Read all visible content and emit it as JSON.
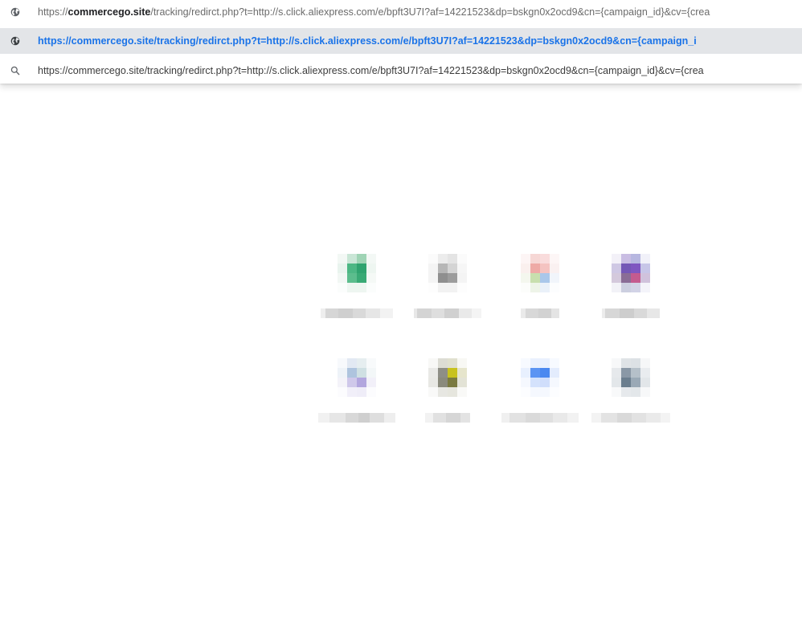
{
  "omnibox_suggestions": [
    {
      "icon": "globe-icon",
      "url_prefix": "https://",
      "url_domain": "commercego.site",
      "url_rest": "/tracking/redirct.php?t=http://s.click.aliexpress.com/e/bpft3U7I?af=14221523&dp=bskgn0x2ocd9&cn={campaign_id}&cv={crea"
    },
    {
      "icon": "globe-icon",
      "url": "https://commercego.site/tracking/redirct.php?t=http://s.click.aliexpress.com/e/bpft3U7I?af=14221523&dp=bskgn0x2ocd9&cn={campaign_i",
      "selected": true
    },
    {
      "icon": "search-icon",
      "url": "https://commercego.site/tracking/redirct.php?t=http://s.click.aliexpress.com/e/bpft3U7I?af=14221523&dp=bskgn0x2ocd9&cn={campaign_id}&cv={crea"
    }
  ],
  "colors": {
    "selected_row_bg": "#e3e5e8",
    "selected_text": "#1a73e8"
  },
  "shortcuts": [
    {
      "icon": "blurred-favicon-green",
      "colors": [
        "#f3f8f5",
        "#c9e6d6",
        "#9fd4b5",
        "#f3f8f5",
        "#e9f4ee",
        "#4cb784",
        "#2fa36f",
        "#eef6f1",
        "#f2f7f4",
        "#5cbd8d",
        "#39aa75",
        "#f5f9f6",
        "#fbfdfc",
        "#eef6f1",
        "#eef6f1",
        "#fbfdfc"
      ]
    },
    {
      "icon": "blurred-favicon-gray",
      "colors": [
        "#fbfbfb",
        "#ececec",
        "#e4e4e4",
        "#fbfbfb",
        "#f4f4f4",
        "#b6b6b6",
        "#d4d4d4",
        "#f6f6f6",
        "#f4f4f4",
        "#8f8f8f",
        "#9c9c9c",
        "#f4f4f4",
        "#fdfdfd",
        "#f2f2f2",
        "#f2f2f2",
        "#fdfdfd"
      ]
    },
    {
      "icon": "blurred-favicon-multicolor",
      "colors": [
        "#fdf5f5",
        "#f6d7d5",
        "#f9dcdc",
        "#fdf6f6",
        "#faf0ee",
        "#eeaaa6",
        "#f4c3c1",
        "#faf1f1",
        "#f4f7ee",
        "#c8dfae",
        "#a9c7ea",
        "#f1f5fb",
        "#fcfdfb",
        "#eef4e8",
        "#eaf1f9",
        "#fcfdfe"
      ]
    },
    {
      "icon": "blurred-favicon-purple",
      "colors": [
        "#f3f1f8",
        "#c9bde3",
        "#b7b7e0",
        "#f1f1f9",
        "#cfc8e4",
        "#7458b6",
        "#7f57c1",
        "#c7c6e8",
        "#d4c9dc",
        "#8a6d96",
        "#c45b8f",
        "#d0c2dc",
        "#f2f2f7",
        "#cccfe0",
        "#d2d3e6",
        "#f4f4fa"
      ]
    },
    {
      "icon": "blurred-favicon-lavender",
      "colors": [
        "#f7f9fc",
        "#e2e9f3",
        "#e6eef0",
        "#f8fafb",
        "#eef3f8",
        "#aec4de",
        "#cfe0e3",
        "#f3f7f8",
        "#f4f3f9",
        "#cfc8ea",
        "#b2a6de",
        "#f2f0f9",
        "#fcfcfe",
        "#f1eff9",
        "#efedf8",
        "#fcfcfe"
      ]
    },
    {
      "icon": "blurred-favicon-olive",
      "colors": [
        "#f8f8f6",
        "#dcdcd4",
        "#e0e0cf",
        "#f8f8f4",
        "#e9e9e6",
        "#8e8e86",
        "#c8c21e",
        "#e6e5cc",
        "#e8e8e4",
        "#8a8a7c",
        "#7a7a40",
        "#e3e3d6",
        "#f9f9f8",
        "#e7e7e2",
        "#e6e6de",
        "#f9f9f7"
      ]
    },
    {
      "icon": "blurred-favicon-blue",
      "colors": [
        "#f7faff",
        "#eaf1fe",
        "#eaf1fe",
        "#f7faff",
        "#e8f0fe",
        "#5b94f3",
        "#4a88f0",
        "#e3ecfd",
        "#f5f8fe",
        "#d4e2fc",
        "#d0defb",
        "#f5f8fe",
        "#fcfdff",
        "#f5f8fe",
        "#f5f8fe",
        "#fcfdff"
      ]
    },
    {
      "icon": "blurred-favicon-slate",
      "colors": [
        "#f7f8f9",
        "#dfe3e6",
        "#dce1e5",
        "#f6f7f8",
        "#e6e9ec",
        "#8a98a6",
        "#b5c0c9",
        "#e9ecef",
        "#e3e7ea",
        "#6b7e8e",
        "#9aa9b6",
        "#e2e6e9",
        "#f8f9fa",
        "#e6e9ec",
        "#e3e7ea",
        "#f7f8f9"
      ]
    }
  ],
  "shortcut_labels": [
    [
      "#eeeeee",
      "#d6d6d6",
      "#cfcfcf",
      "#d9d9d9",
      "#e6e6e6",
      "#f2f2f2"
    ],
    [
      "#e8e8e8",
      "#d4d4d4",
      "#dedede",
      "#d0d0d0",
      "#e9e9e9",
      "#f4f4f4"
    ],
    [
      "#eaeaea",
      "#d8d8d8",
      "#d2d2d2",
      "#e4e4e4"
    ],
    [
      "#ececec",
      "#d7d7d7",
      "#cdcdcd",
      "#d9d9d9",
      "#e7e7e7"
    ],
    [
      "#f1f1f1",
      "#e6e6e6",
      "#d8d8d8",
      "#cfcfcf",
      "#dedede",
      "#eeeeee"
    ],
    [
      "#f2f2f2",
      "#e1e1e1",
      "#d6d6d6",
      "#e3e3e3"
    ],
    [
      "#f0f0f0",
      "#e2e2e2",
      "#dadada",
      "#e0e0e0",
      "#e9e9e9",
      "#f2f2f2"
    ],
    [
      "#f3f3f3",
      "#e3e3e3",
      "#d9d9d9",
      "#e2e2e2",
      "#eaeaea",
      "#f3f3f3"
    ]
  ]
}
